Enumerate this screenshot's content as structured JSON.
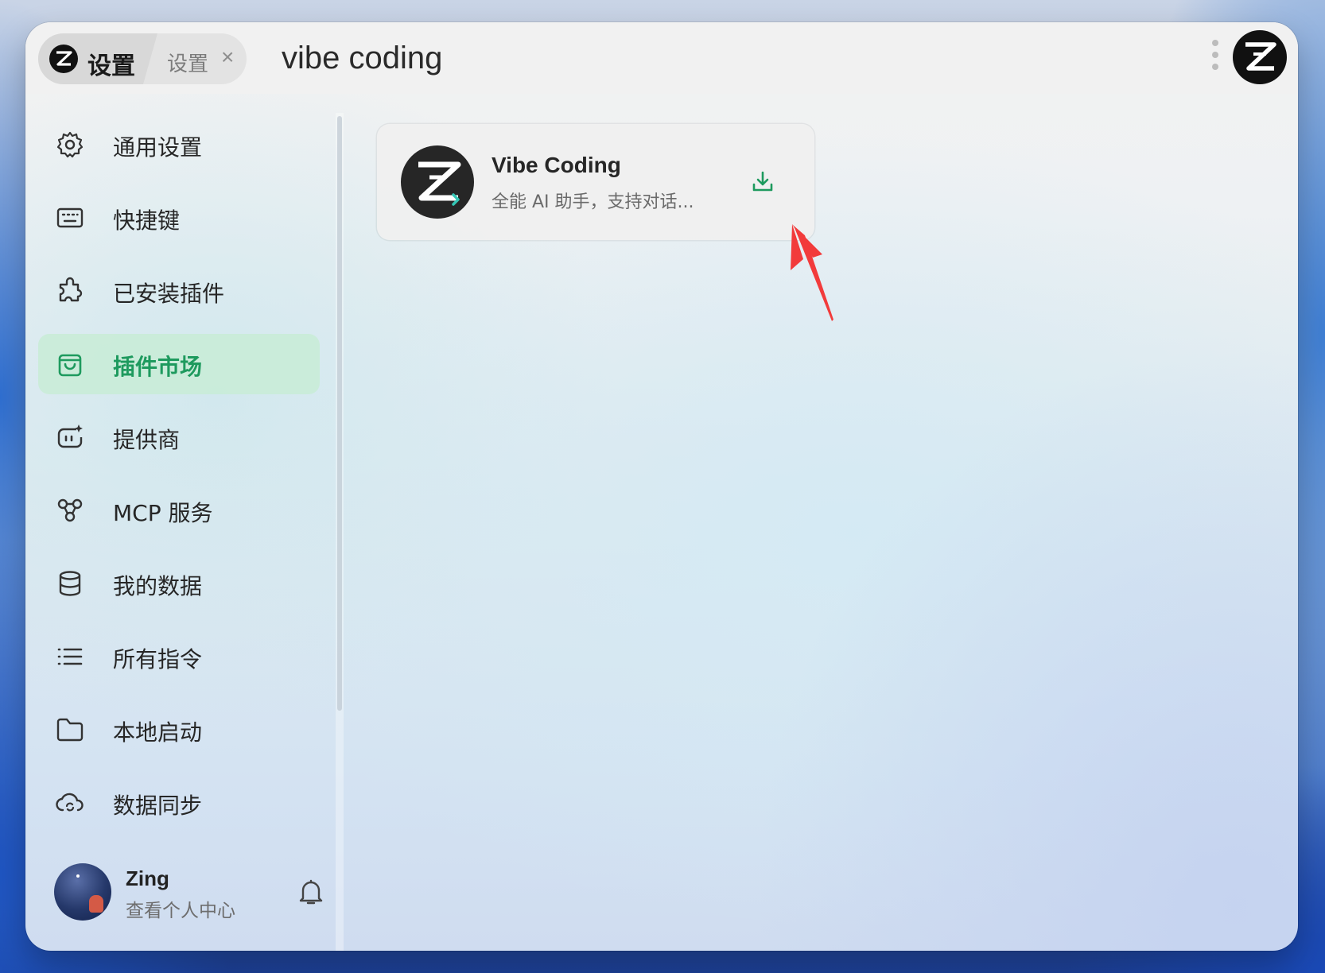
{
  "header": {
    "active_tab_label": "设置",
    "second_tab_label": "设置",
    "close_glyph": "×",
    "search_value": "vibe coding",
    "icons": [
      "z-logo-icon",
      "close-icon",
      "more-vertical-icon",
      "app-logo-icon"
    ]
  },
  "sidebar": {
    "items": [
      {
        "label": "通用设置",
        "icon": "gear-icon"
      },
      {
        "label": "快捷键",
        "icon": "keyboard-icon"
      },
      {
        "label": "已安装插件",
        "icon": "plugin-icon"
      },
      {
        "label": "插件市场",
        "icon": "shopping-bag-icon",
        "active": true
      },
      {
        "label": "提供商",
        "icon": "provider-icon"
      },
      {
        "label": "MCP 服务",
        "icon": "mcp-icon"
      },
      {
        "label": "我的数据",
        "icon": "database-icon"
      },
      {
        "label": "所有指令",
        "icon": "list-icon"
      },
      {
        "label": "本地启动",
        "icon": "folder-icon"
      },
      {
        "label": "数据同步",
        "icon": "cloud-sync-icon"
      }
    ],
    "user": {
      "name": "Zing",
      "subtitle": "查看个人中心",
      "icons": [
        "avatar",
        "bell-icon"
      ]
    }
  },
  "results": [
    {
      "title": "Vibe Coding",
      "description": "全能 AI 助手，支持对话...",
      "action_icon": "download-icon"
    }
  ],
  "colors": {
    "accent": "#1e9a5e",
    "active_bg": "#c8ecd6",
    "annotation_arrow": "#f23b3b",
    "logo_bg": "#111111"
  }
}
